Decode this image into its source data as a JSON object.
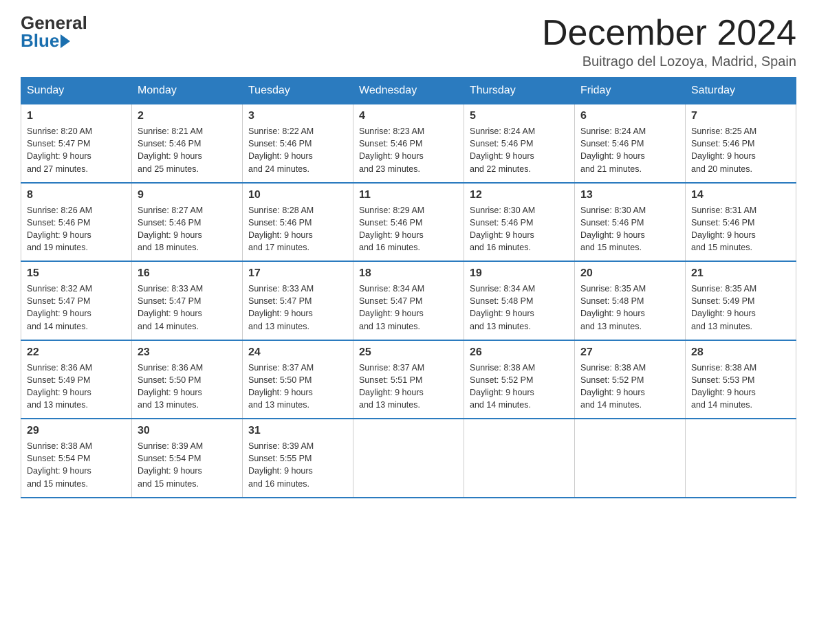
{
  "header": {
    "logo_general": "General",
    "logo_blue": "Blue",
    "month_title": "December 2024",
    "location": "Buitrago del Lozoya, Madrid, Spain"
  },
  "days_of_week": [
    "Sunday",
    "Monday",
    "Tuesday",
    "Wednesday",
    "Thursday",
    "Friday",
    "Saturday"
  ],
  "weeks": [
    [
      {
        "num": "1",
        "sunrise": "8:20 AM",
        "sunset": "5:47 PM",
        "daylight": "9 hours and 27 minutes."
      },
      {
        "num": "2",
        "sunrise": "8:21 AM",
        "sunset": "5:46 PM",
        "daylight": "9 hours and 25 minutes."
      },
      {
        "num": "3",
        "sunrise": "8:22 AM",
        "sunset": "5:46 PM",
        "daylight": "9 hours and 24 minutes."
      },
      {
        "num": "4",
        "sunrise": "8:23 AM",
        "sunset": "5:46 PM",
        "daylight": "9 hours and 23 minutes."
      },
      {
        "num": "5",
        "sunrise": "8:24 AM",
        "sunset": "5:46 PM",
        "daylight": "9 hours and 22 minutes."
      },
      {
        "num": "6",
        "sunrise": "8:24 AM",
        "sunset": "5:46 PM",
        "daylight": "9 hours and 21 minutes."
      },
      {
        "num": "7",
        "sunrise": "8:25 AM",
        "sunset": "5:46 PM",
        "daylight": "9 hours and 20 minutes."
      }
    ],
    [
      {
        "num": "8",
        "sunrise": "8:26 AM",
        "sunset": "5:46 PM",
        "daylight": "9 hours and 19 minutes."
      },
      {
        "num": "9",
        "sunrise": "8:27 AM",
        "sunset": "5:46 PM",
        "daylight": "9 hours and 18 minutes."
      },
      {
        "num": "10",
        "sunrise": "8:28 AM",
        "sunset": "5:46 PM",
        "daylight": "9 hours and 17 minutes."
      },
      {
        "num": "11",
        "sunrise": "8:29 AM",
        "sunset": "5:46 PM",
        "daylight": "9 hours and 16 minutes."
      },
      {
        "num": "12",
        "sunrise": "8:30 AM",
        "sunset": "5:46 PM",
        "daylight": "9 hours and 16 minutes."
      },
      {
        "num": "13",
        "sunrise": "8:30 AM",
        "sunset": "5:46 PM",
        "daylight": "9 hours and 15 minutes."
      },
      {
        "num": "14",
        "sunrise": "8:31 AM",
        "sunset": "5:46 PM",
        "daylight": "9 hours and 15 minutes."
      }
    ],
    [
      {
        "num": "15",
        "sunrise": "8:32 AM",
        "sunset": "5:47 PM",
        "daylight": "9 hours and 14 minutes."
      },
      {
        "num": "16",
        "sunrise": "8:33 AM",
        "sunset": "5:47 PM",
        "daylight": "9 hours and 14 minutes."
      },
      {
        "num": "17",
        "sunrise": "8:33 AM",
        "sunset": "5:47 PM",
        "daylight": "9 hours and 13 minutes."
      },
      {
        "num": "18",
        "sunrise": "8:34 AM",
        "sunset": "5:47 PM",
        "daylight": "9 hours and 13 minutes."
      },
      {
        "num": "19",
        "sunrise": "8:34 AM",
        "sunset": "5:48 PM",
        "daylight": "9 hours and 13 minutes."
      },
      {
        "num": "20",
        "sunrise": "8:35 AM",
        "sunset": "5:48 PM",
        "daylight": "9 hours and 13 minutes."
      },
      {
        "num": "21",
        "sunrise": "8:35 AM",
        "sunset": "5:49 PM",
        "daylight": "9 hours and 13 minutes."
      }
    ],
    [
      {
        "num": "22",
        "sunrise": "8:36 AM",
        "sunset": "5:49 PM",
        "daylight": "9 hours and 13 minutes."
      },
      {
        "num": "23",
        "sunrise": "8:36 AM",
        "sunset": "5:50 PM",
        "daylight": "9 hours and 13 minutes."
      },
      {
        "num": "24",
        "sunrise": "8:37 AM",
        "sunset": "5:50 PM",
        "daylight": "9 hours and 13 minutes."
      },
      {
        "num": "25",
        "sunrise": "8:37 AM",
        "sunset": "5:51 PM",
        "daylight": "9 hours and 13 minutes."
      },
      {
        "num": "26",
        "sunrise": "8:38 AM",
        "sunset": "5:52 PM",
        "daylight": "9 hours and 14 minutes."
      },
      {
        "num": "27",
        "sunrise": "8:38 AM",
        "sunset": "5:52 PM",
        "daylight": "9 hours and 14 minutes."
      },
      {
        "num": "28",
        "sunrise": "8:38 AM",
        "sunset": "5:53 PM",
        "daylight": "9 hours and 14 minutes."
      }
    ],
    [
      {
        "num": "29",
        "sunrise": "8:38 AM",
        "sunset": "5:54 PM",
        "daylight": "9 hours and 15 minutes."
      },
      {
        "num": "30",
        "sunrise": "8:39 AM",
        "sunset": "5:54 PM",
        "daylight": "9 hours and 15 minutes."
      },
      {
        "num": "31",
        "sunrise": "8:39 AM",
        "sunset": "5:55 PM",
        "daylight": "9 hours and 16 minutes."
      },
      null,
      null,
      null,
      null
    ]
  ],
  "labels": {
    "sunrise": "Sunrise:",
    "sunset": "Sunset:",
    "daylight": "Daylight:"
  }
}
